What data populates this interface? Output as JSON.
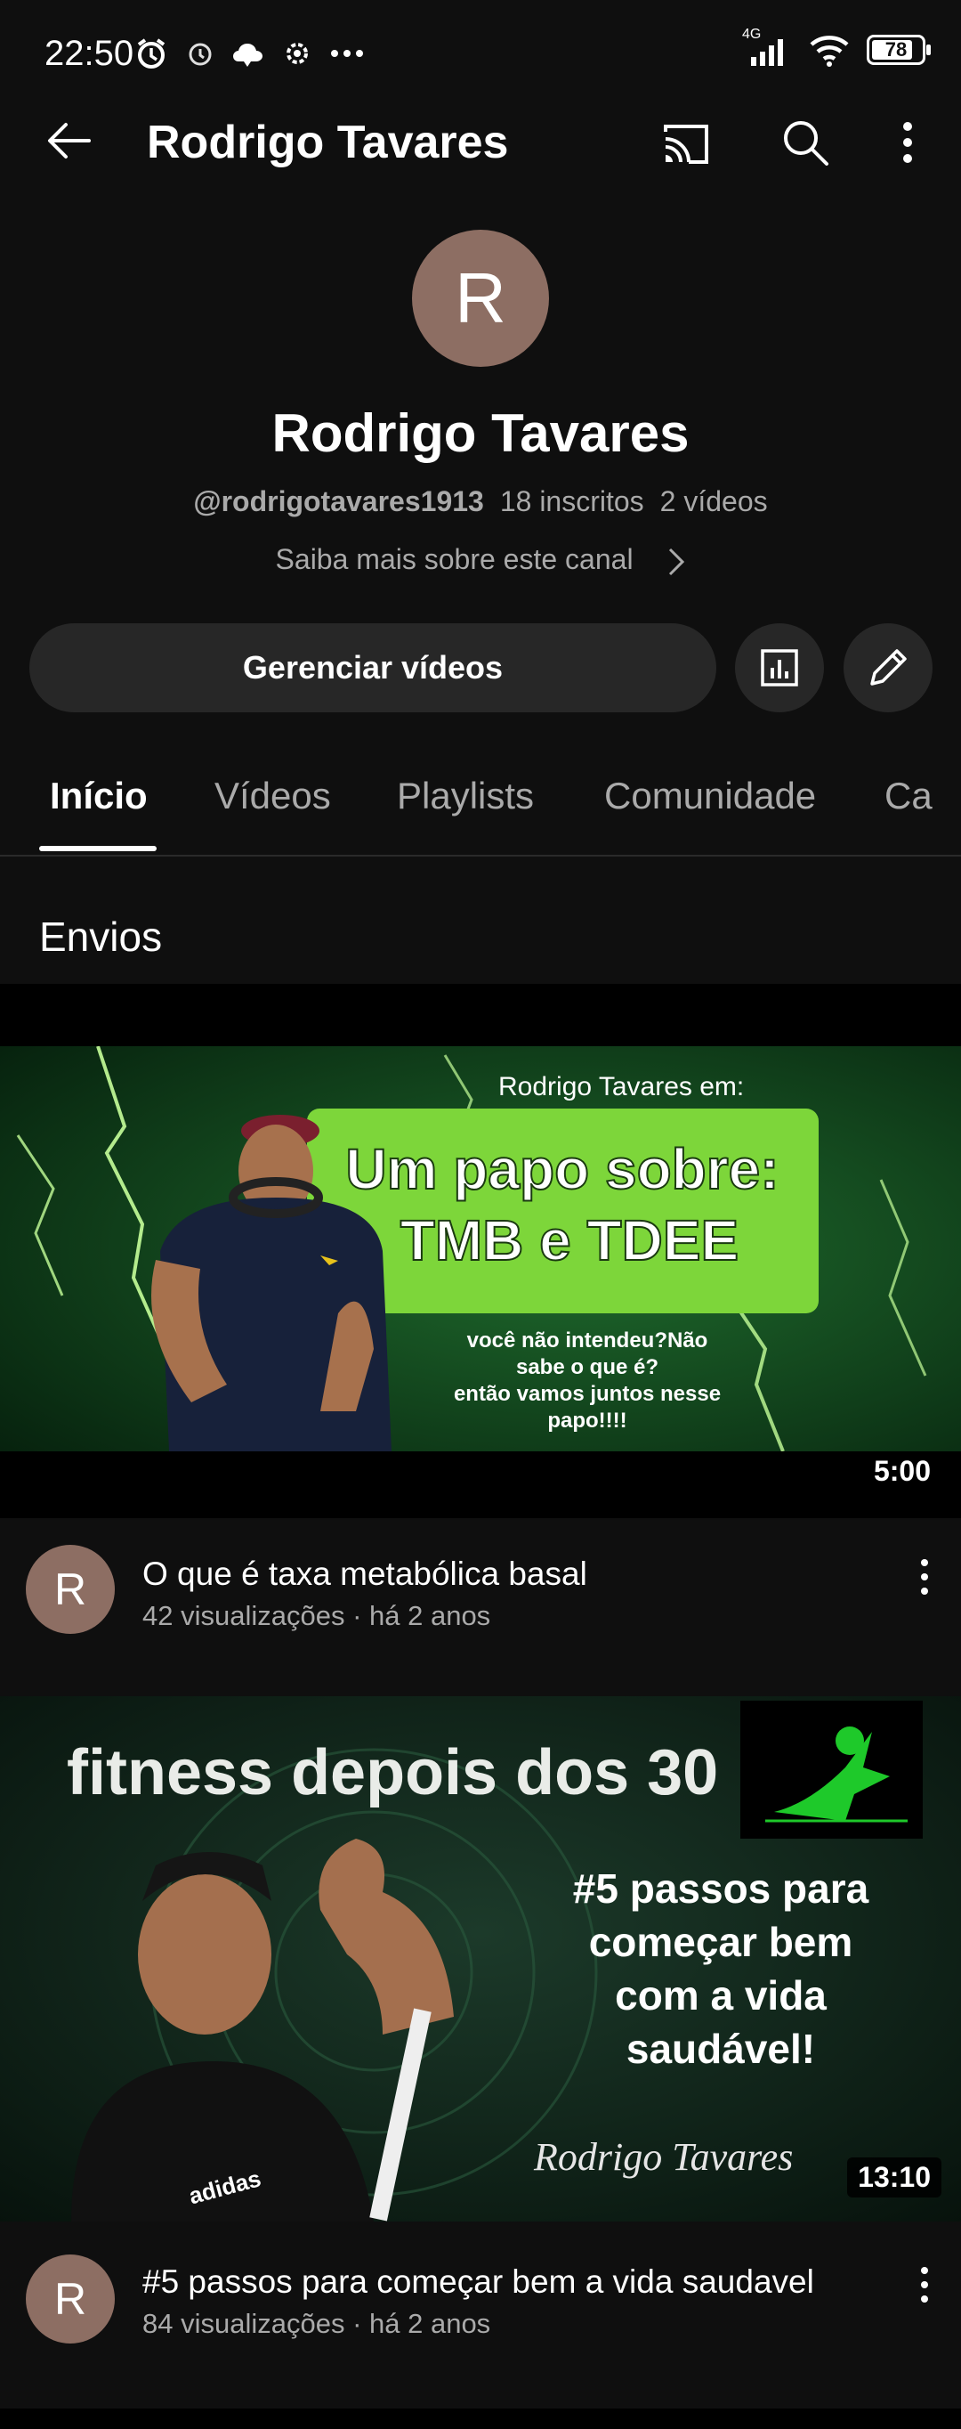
{
  "status_bar": {
    "time": "22:50",
    "left_icons": [
      "alarm-icon",
      "alarm-clock-icon",
      "cloud-icon",
      "settings-icon",
      "more-dots-icon"
    ],
    "network": "4G",
    "battery": "78"
  },
  "topbar": {
    "title": "Rodrigo Tavares",
    "icons": [
      "back-arrow-icon",
      "cast-icon",
      "search-icon",
      "more-vert-icon"
    ]
  },
  "channel": {
    "avatar_letter": "R",
    "name": "Rodrigo Tavares",
    "handle": "@rodrigotavares1913",
    "subscribers": "18 inscritos",
    "videos": "2 vídeos",
    "about": "Saiba mais sobre este canal",
    "manage_button": "Gerenciar vídeos"
  },
  "tabs": [
    {
      "label": "Início",
      "active": true
    },
    {
      "label": "Vídeos",
      "active": false
    },
    {
      "label": "Playlists",
      "active": false
    },
    {
      "label": "Comunidade",
      "active": false
    },
    {
      "label": "Ca",
      "active": false
    }
  ],
  "section_title": "Envios",
  "videos": [
    {
      "title": "O que é taxa metabólica basal",
      "meta": "42 visualizações · há 2 anos",
      "duration": "5:00",
      "avatar_letter": "R",
      "thumb_text": {
        "byline": "Rodrigo Tavares em:",
        "headline1": "Um papo sobre:",
        "headline2": "TMB e TDEE",
        "sub1": "você não intendeu?Não",
        "sub2": "sabe o que é?",
        "sub3": "então vamos juntos nesse",
        "sub4": "papo!!!!"
      }
    },
    {
      "title": "#5 passos para começar bem a vida saudavel",
      "meta": "84 visualizações · há 2 anos",
      "duration": "13:10",
      "avatar_letter": "R",
      "thumb_text": {
        "headline": "fitness depois dos 30",
        "line1": "#5 passos para",
        "line2": "começar bem",
        "line3": "com a vida",
        "line4": "saudável!",
        "signature": "Rodrigo Tavares",
        "shirt_logo": "adidas"
      }
    }
  ],
  "colors": {
    "background": "#0f0f0f",
    "avatar": "#8d6e63",
    "button": "#272727",
    "thumb1_bg": "#0d3a17",
    "thumb1_box": "#7dd63a",
    "thumb2_bg": "#0e1a14"
  }
}
